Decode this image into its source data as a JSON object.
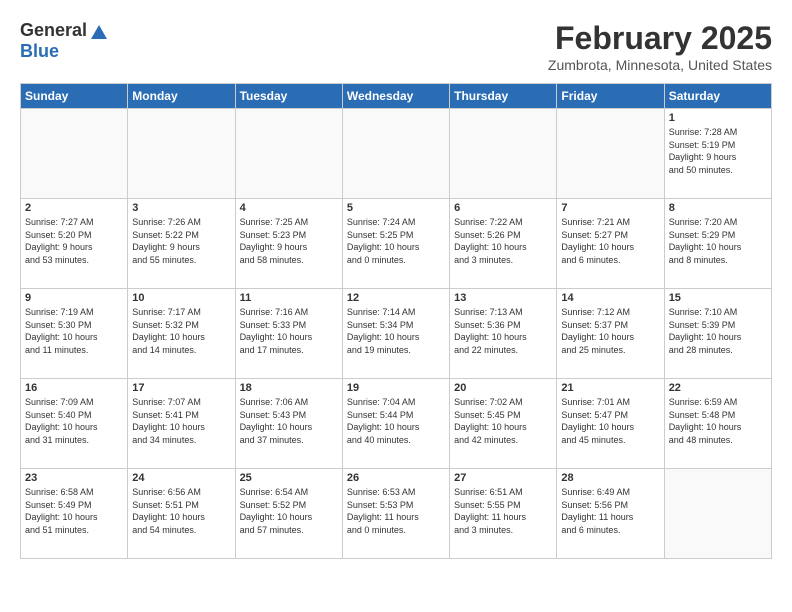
{
  "header": {
    "logo_general": "General",
    "logo_blue": "Blue",
    "month_year": "February 2025",
    "location": "Zumbrota, Minnesota, United States"
  },
  "days_of_week": [
    "Sunday",
    "Monday",
    "Tuesday",
    "Wednesday",
    "Thursday",
    "Friday",
    "Saturday"
  ],
  "weeks": [
    [
      {
        "day": "",
        "content": ""
      },
      {
        "day": "",
        "content": ""
      },
      {
        "day": "",
        "content": ""
      },
      {
        "day": "",
        "content": ""
      },
      {
        "day": "",
        "content": ""
      },
      {
        "day": "",
        "content": ""
      },
      {
        "day": "1",
        "content": "Sunrise: 7:28 AM\nSunset: 5:19 PM\nDaylight: 9 hours\nand 50 minutes."
      }
    ],
    [
      {
        "day": "2",
        "content": "Sunrise: 7:27 AM\nSunset: 5:20 PM\nDaylight: 9 hours\nand 53 minutes."
      },
      {
        "day": "3",
        "content": "Sunrise: 7:26 AM\nSunset: 5:22 PM\nDaylight: 9 hours\nand 55 minutes."
      },
      {
        "day": "4",
        "content": "Sunrise: 7:25 AM\nSunset: 5:23 PM\nDaylight: 9 hours\nand 58 minutes."
      },
      {
        "day": "5",
        "content": "Sunrise: 7:24 AM\nSunset: 5:25 PM\nDaylight: 10 hours\nand 0 minutes."
      },
      {
        "day": "6",
        "content": "Sunrise: 7:22 AM\nSunset: 5:26 PM\nDaylight: 10 hours\nand 3 minutes."
      },
      {
        "day": "7",
        "content": "Sunrise: 7:21 AM\nSunset: 5:27 PM\nDaylight: 10 hours\nand 6 minutes."
      },
      {
        "day": "8",
        "content": "Sunrise: 7:20 AM\nSunset: 5:29 PM\nDaylight: 10 hours\nand 8 minutes."
      }
    ],
    [
      {
        "day": "9",
        "content": "Sunrise: 7:19 AM\nSunset: 5:30 PM\nDaylight: 10 hours\nand 11 minutes."
      },
      {
        "day": "10",
        "content": "Sunrise: 7:17 AM\nSunset: 5:32 PM\nDaylight: 10 hours\nand 14 minutes."
      },
      {
        "day": "11",
        "content": "Sunrise: 7:16 AM\nSunset: 5:33 PM\nDaylight: 10 hours\nand 17 minutes."
      },
      {
        "day": "12",
        "content": "Sunrise: 7:14 AM\nSunset: 5:34 PM\nDaylight: 10 hours\nand 19 minutes."
      },
      {
        "day": "13",
        "content": "Sunrise: 7:13 AM\nSunset: 5:36 PM\nDaylight: 10 hours\nand 22 minutes."
      },
      {
        "day": "14",
        "content": "Sunrise: 7:12 AM\nSunset: 5:37 PM\nDaylight: 10 hours\nand 25 minutes."
      },
      {
        "day": "15",
        "content": "Sunrise: 7:10 AM\nSunset: 5:39 PM\nDaylight: 10 hours\nand 28 minutes."
      }
    ],
    [
      {
        "day": "16",
        "content": "Sunrise: 7:09 AM\nSunset: 5:40 PM\nDaylight: 10 hours\nand 31 minutes."
      },
      {
        "day": "17",
        "content": "Sunrise: 7:07 AM\nSunset: 5:41 PM\nDaylight: 10 hours\nand 34 minutes."
      },
      {
        "day": "18",
        "content": "Sunrise: 7:06 AM\nSunset: 5:43 PM\nDaylight: 10 hours\nand 37 minutes."
      },
      {
        "day": "19",
        "content": "Sunrise: 7:04 AM\nSunset: 5:44 PM\nDaylight: 10 hours\nand 40 minutes."
      },
      {
        "day": "20",
        "content": "Sunrise: 7:02 AM\nSunset: 5:45 PM\nDaylight: 10 hours\nand 42 minutes."
      },
      {
        "day": "21",
        "content": "Sunrise: 7:01 AM\nSunset: 5:47 PM\nDaylight: 10 hours\nand 45 minutes."
      },
      {
        "day": "22",
        "content": "Sunrise: 6:59 AM\nSunset: 5:48 PM\nDaylight: 10 hours\nand 48 minutes."
      }
    ],
    [
      {
        "day": "23",
        "content": "Sunrise: 6:58 AM\nSunset: 5:49 PM\nDaylight: 10 hours\nand 51 minutes."
      },
      {
        "day": "24",
        "content": "Sunrise: 6:56 AM\nSunset: 5:51 PM\nDaylight: 10 hours\nand 54 minutes."
      },
      {
        "day": "25",
        "content": "Sunrise: 6:54 AM\nSunset: 5:52 PM\nDaylight: 10 hours\nand 57 minutes."
      },
      {
        "day": "26",
        "content": "Sunrise: 6:53 AM\nSunset: 5:53 PM\nDaylight: 11 hours\nand 0 minutes."
      },
      {
        "day": "27",
        "content": "Sunrise: 6:51 AM\nSunset: 5:55 PM\nDaylight: 11 hours\nand 3 minutes."
      },
      {
        "day": "28",
        "content": "Sunrise: 6:49 AM\nSunset: 5:56 PM\nDaylight: 11 hours\nand 6 minutes."
      },
      {
        "day": "",
        "content": ""
      }
    ]
  ]
}
